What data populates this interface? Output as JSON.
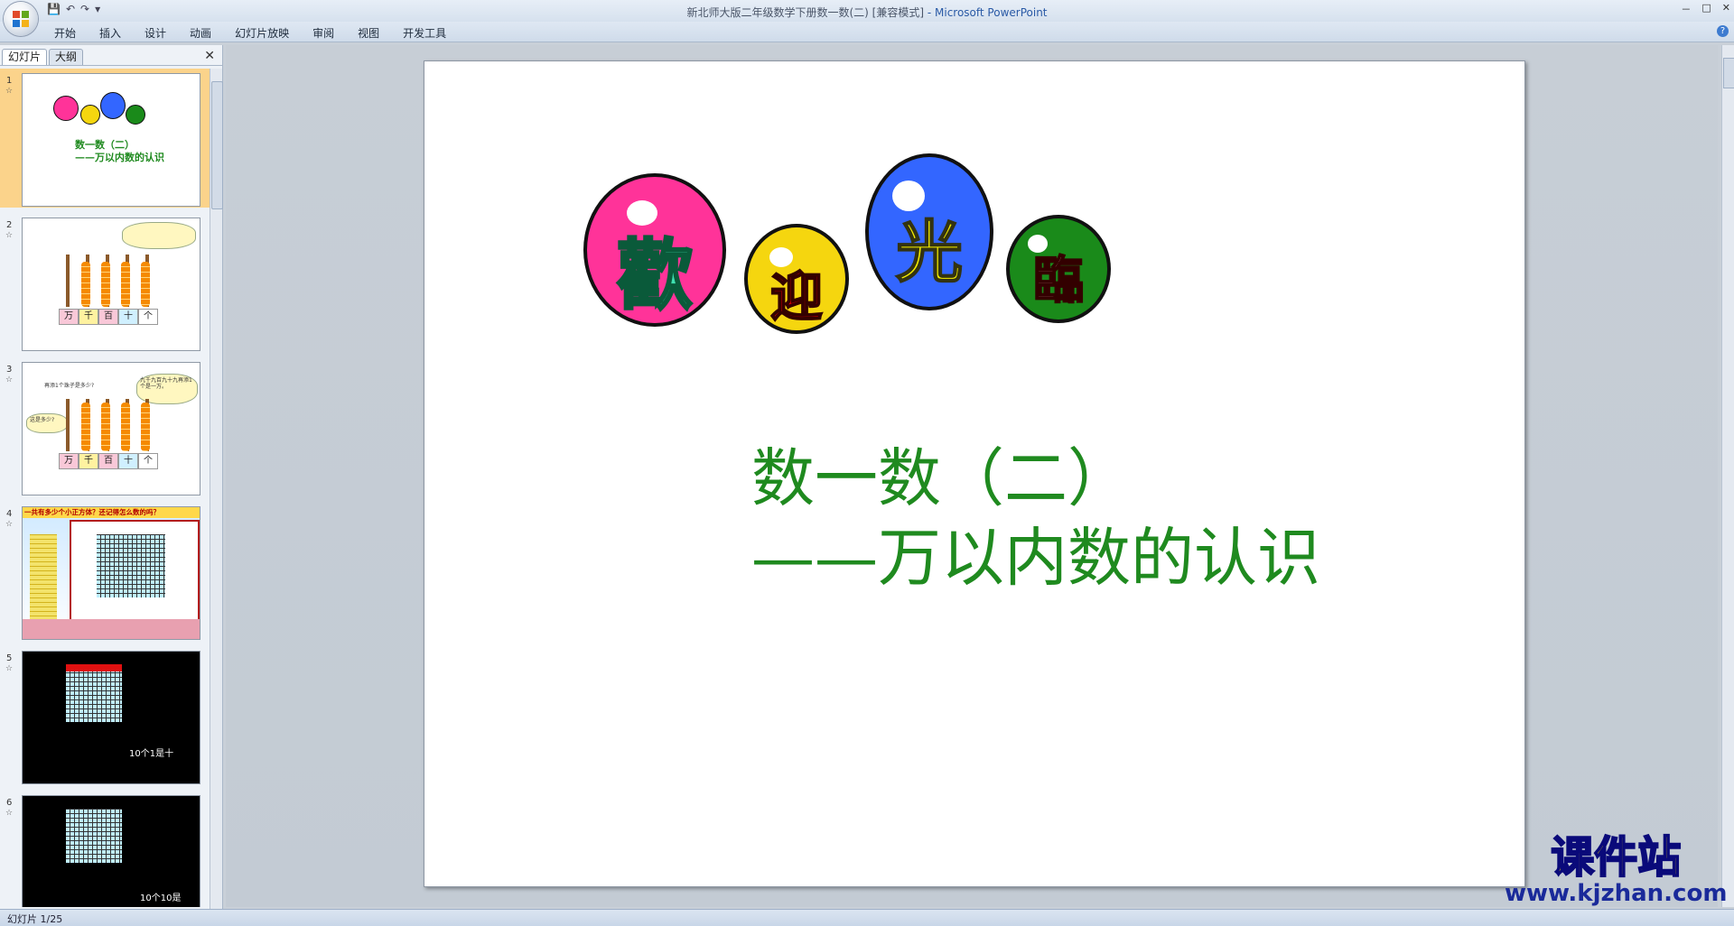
{
  "window": {
    "title": "新北师大版二年级数学下册数一数(二) [兼容模式]",
    "title_sep": " - ",
    "app_name": "Microsoft PowerPoint",
    "controls": [
      "－",
      "□",
      "✕"
    ]
  },
  "qat": {
    "save_icon": "save-icon",
    "undo_label": "↶",
    "redo_label": "↷",
    "customize_label": "▾"
  },
  "ribbon": {
    "tabs": [
      "开始",
      "插入",
      "设计",
      "动画",
      "幻灯片放映",
      "审阅",
      "视图",
      "开发工具"
    ],
    "help_label": "?"
  },
  "left_panel": {
    "tabs": [
      "幻灯片",
      "大纲"
    ],
    "close_label": "✕",
    "slides": [
      {
        "num": "1",
        "title": "数一数（二）",
        "subtitle": "——万以内数的认识"
      },
      {
        "num": "2",
        "labels": [
          "万",
          "千",
          "百",
          "十",
          "个"
        ]
      },
      {
        "num": "3",
        "labels": [
          "万",
          "千",
          "百",
          "十",
          "个"
        ],
        "note": "再添1个珠子是多少?",
        "left_bubble": "这是多少?",
        "right_bubble": "九千九百九十九再添1个是一万。"
      },
      {
        "num": "4",
        "caption": "一共有多少个小正方体？还记得怎么数的吗？"
      },
      {
        "num": "5",
        "caption": "10个1是十"
      },
      {
        "num": "6",
        "caption": "10个10是"
      }
    ]
  },
  "slide": {
    "balls": [
      "歡",
      "迎",
      "光",
      "臨"
    ],
    "title": "数一数（二）",
    "subtitle": "——万以内数的认识"
  },
  "status": {
    "text": "幻灯片 1/25"
  },
  "watermark": {
    "line1": "课件站",
    "line2": "www.kjzhan.com"
  },
  "colors": {
    "title_green": "#1f8a1f",
    "ball1": "#ff3399",
    "ball2": "#f5d60f",
    "ball3": "#3366ff",
    "ball4": "#1a8a1a"
  }
}
